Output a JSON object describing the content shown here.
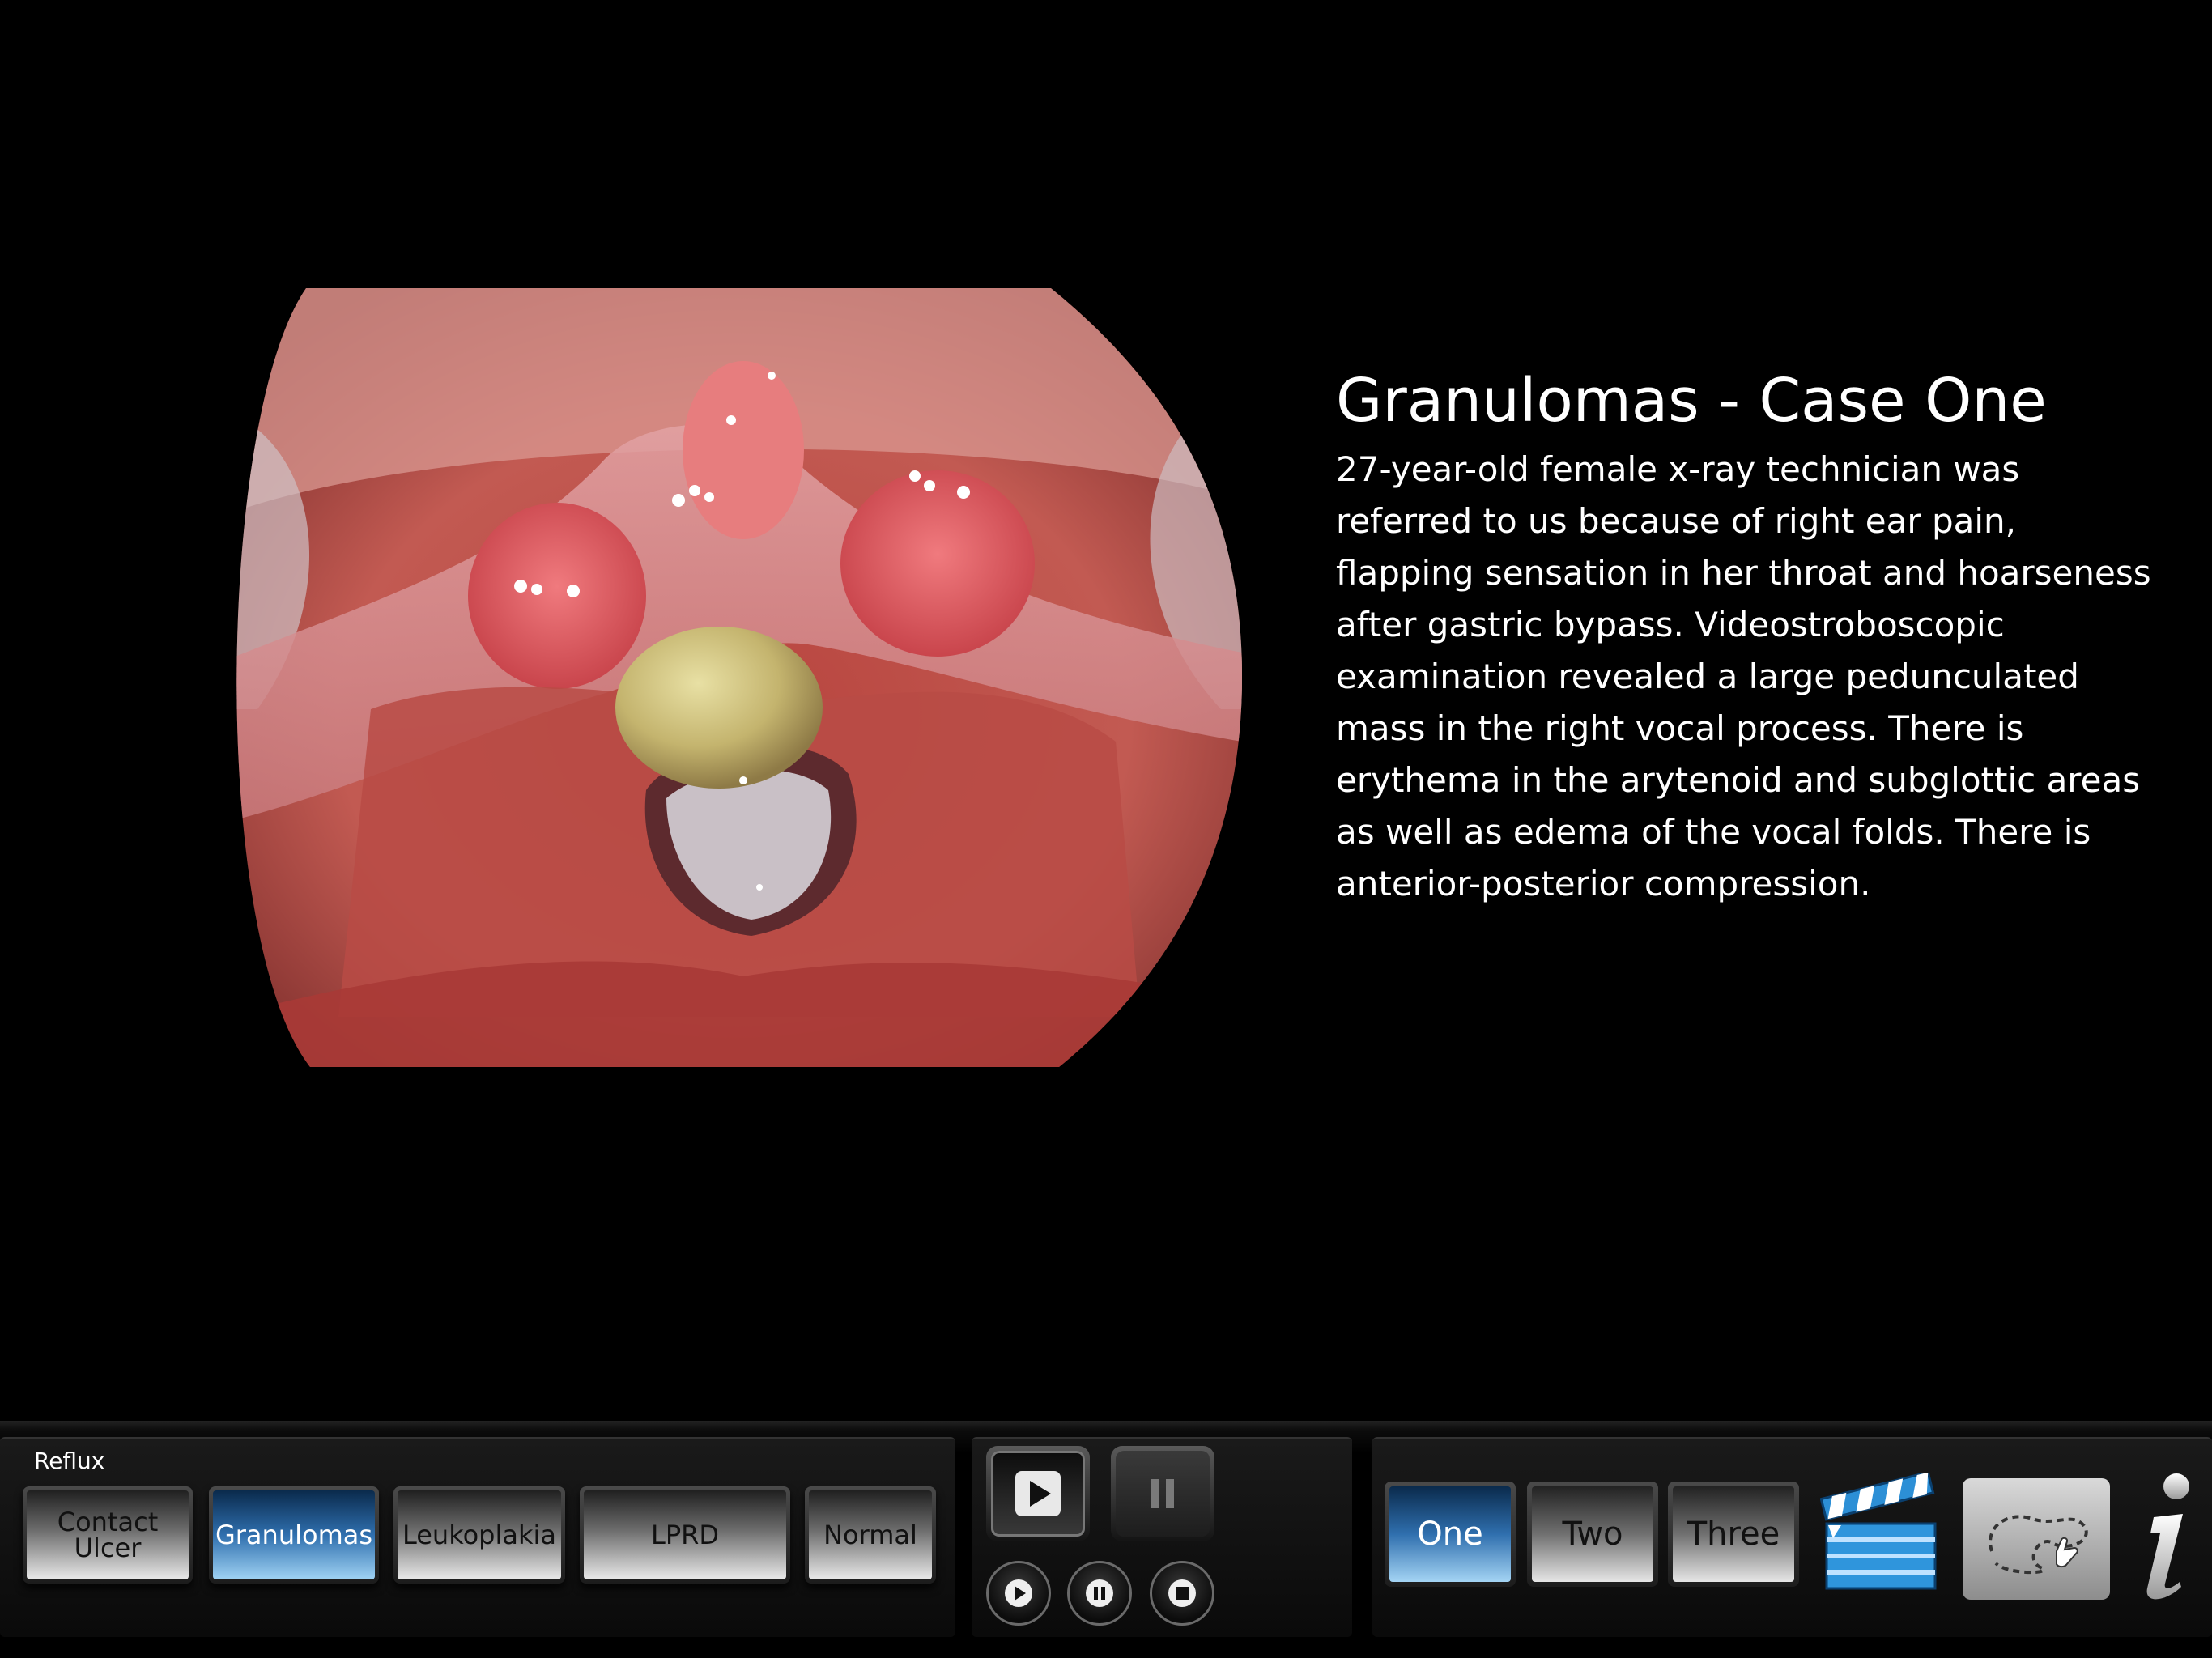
{
  "case": {
    "title": "Granulomas - Case One",
    "description": "27-year-old female x-ray technician was referred to us because of right ear pain, flapping sensation in her throat and hoarseness after gastric bypass. Videostroboscopic examination revealed a large pedunculated mass in the right vocal process. There is erythema in the arytenoid and subglottic areas as well as edema of the vocal folds. There is anterior-posterior compression."
  },
  "category_label": "Reflux",
  "categories": [
    {
      "label_line1": "Contact",
      "label_line2": "Ulcer"
    },
    {
      "label": "Granulomas",
      "active": true
    },
    {
      "label": "Leukoplakia"
    },
    {
      "label": "LPRD"
    },
    {
      "label": "Normal"
    }
  ],
  "media": {
    "icons": [
      "play-icon",
      "pause-icon",
      "play-small-icon",
      "pause-small-icon",
      "stop-icon"
    ]
  },
  "cases": [
    {
      "label": "One",
      "active": true
    },
    {
      "label": "Two"
    },
    {
      "label": "Three"
    }
  ],
  "tools": {
    "icons": [
      "clapperboard-icon",
      "trace-path-icon",
      "info-icon"
    ]
  },
  "colors": {
    "active_blue": "#2f6fae",
    "background": "#000000",
    "tissue": "#c8564e"
  }
}
